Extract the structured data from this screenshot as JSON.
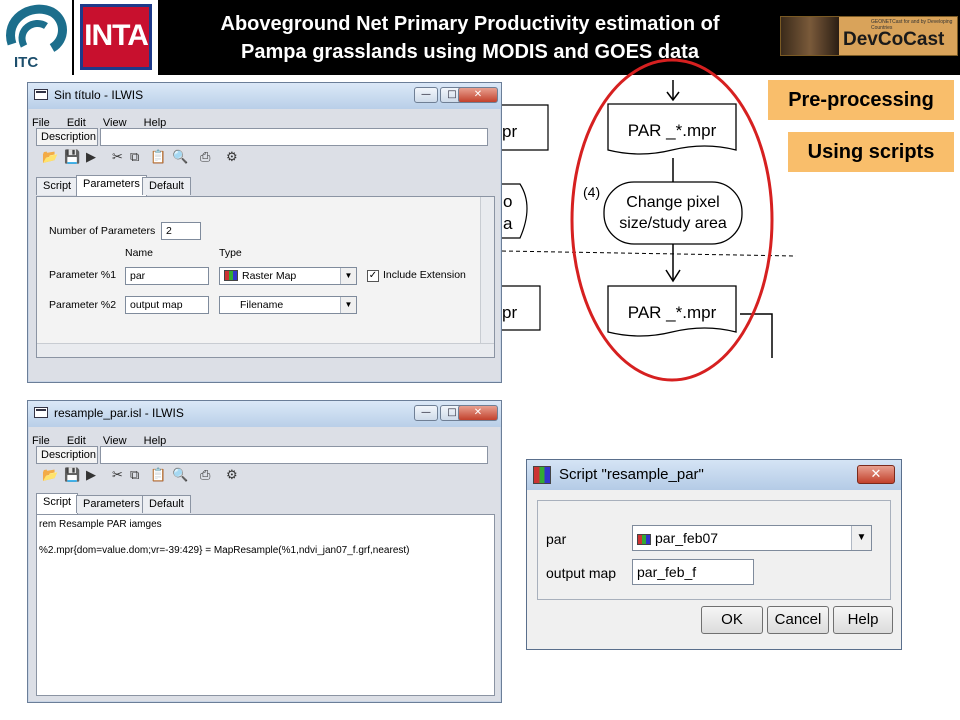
{
  "header": {
    "title_line1": "Aboveground Net Primary Productivity estimation of",
    "title_line2": "Pampa grasslands using MODIS and GOES data",
    "logo_itc": "ITC",
    "logo_inta": "INTA",
    "devcocast": "DevCoCast",
    "devcocast_small": "GEONETCast for and by Developing Countries"
  },
  "labels": {
    "preprocessing": "Pre-processing",
    "using_scripts": "Using scripts"
  },
  "flow": {
    "box_top": "PAR _*.mpr",
    "step_number": "(4)",
    "step_line1": "Change pixel",
    "step_line2": "size/study area",
    "box_bottom": "PAR _*.mpr",
    "partial_top": "pr",
    "partial_mid_1": "o",
    "partial_mid_2": "a",
    "partial_bottom": "pr"
  },
  "window1": {
    "title": "Sin título - ILWIS",
    "menu": [
      "File",
      "Edit",
      "View",
      "Help"
    ],
    "description_label": "Description",
    "tabs": [
      "Script",
      "Parameters",
      "Default Values"
    ],
    "num_params_label": "Number of Parameters",
    "num_params_value": "2",
    "col_name": "Name",
    "col_type": "Type",
    "param1_label": "Parameter %1",
    "param1_name": "par",
    "param1_type": "Raster Map",
    "include_ext_label": "Include Extension",
    "param2_label": "Parameter %2",
    "param2_name": "output map",
    "param2_type": "Filename"
  },
  "window2": {
    "title": "resample_par.isl - ILWIS",
    "menu": [
      "File",
      "Edit",
      "View",
      "Help"
    ],
    "description_label": "Description",
    "tabs": [
      "Script",
      "Parameters",
      "Default Values"
    ],
    "script_line1": "rem Resample PAR iamges",
    "script_line2": "%2.mpr{dom=value.dom;vr=-39:429} = MapResample(%1,ndvi_jan07_f.grf,nearest)"
  },
  "dialog": {
    "title": "Script \"resample_par\"",
    "par_label": "par",
    "par_value": "par_feb07",
    "output_label": "output map",
    "output_value": "par_feb_f",
    "ok": "OK",
    "cancel": "Cancel",
    "help": "Help"
  },
  "colors": {
    "orange": "#f9be6b",
    "red_ellipse": "#d62020",
    "header_bg": "#000000"
  }
}
